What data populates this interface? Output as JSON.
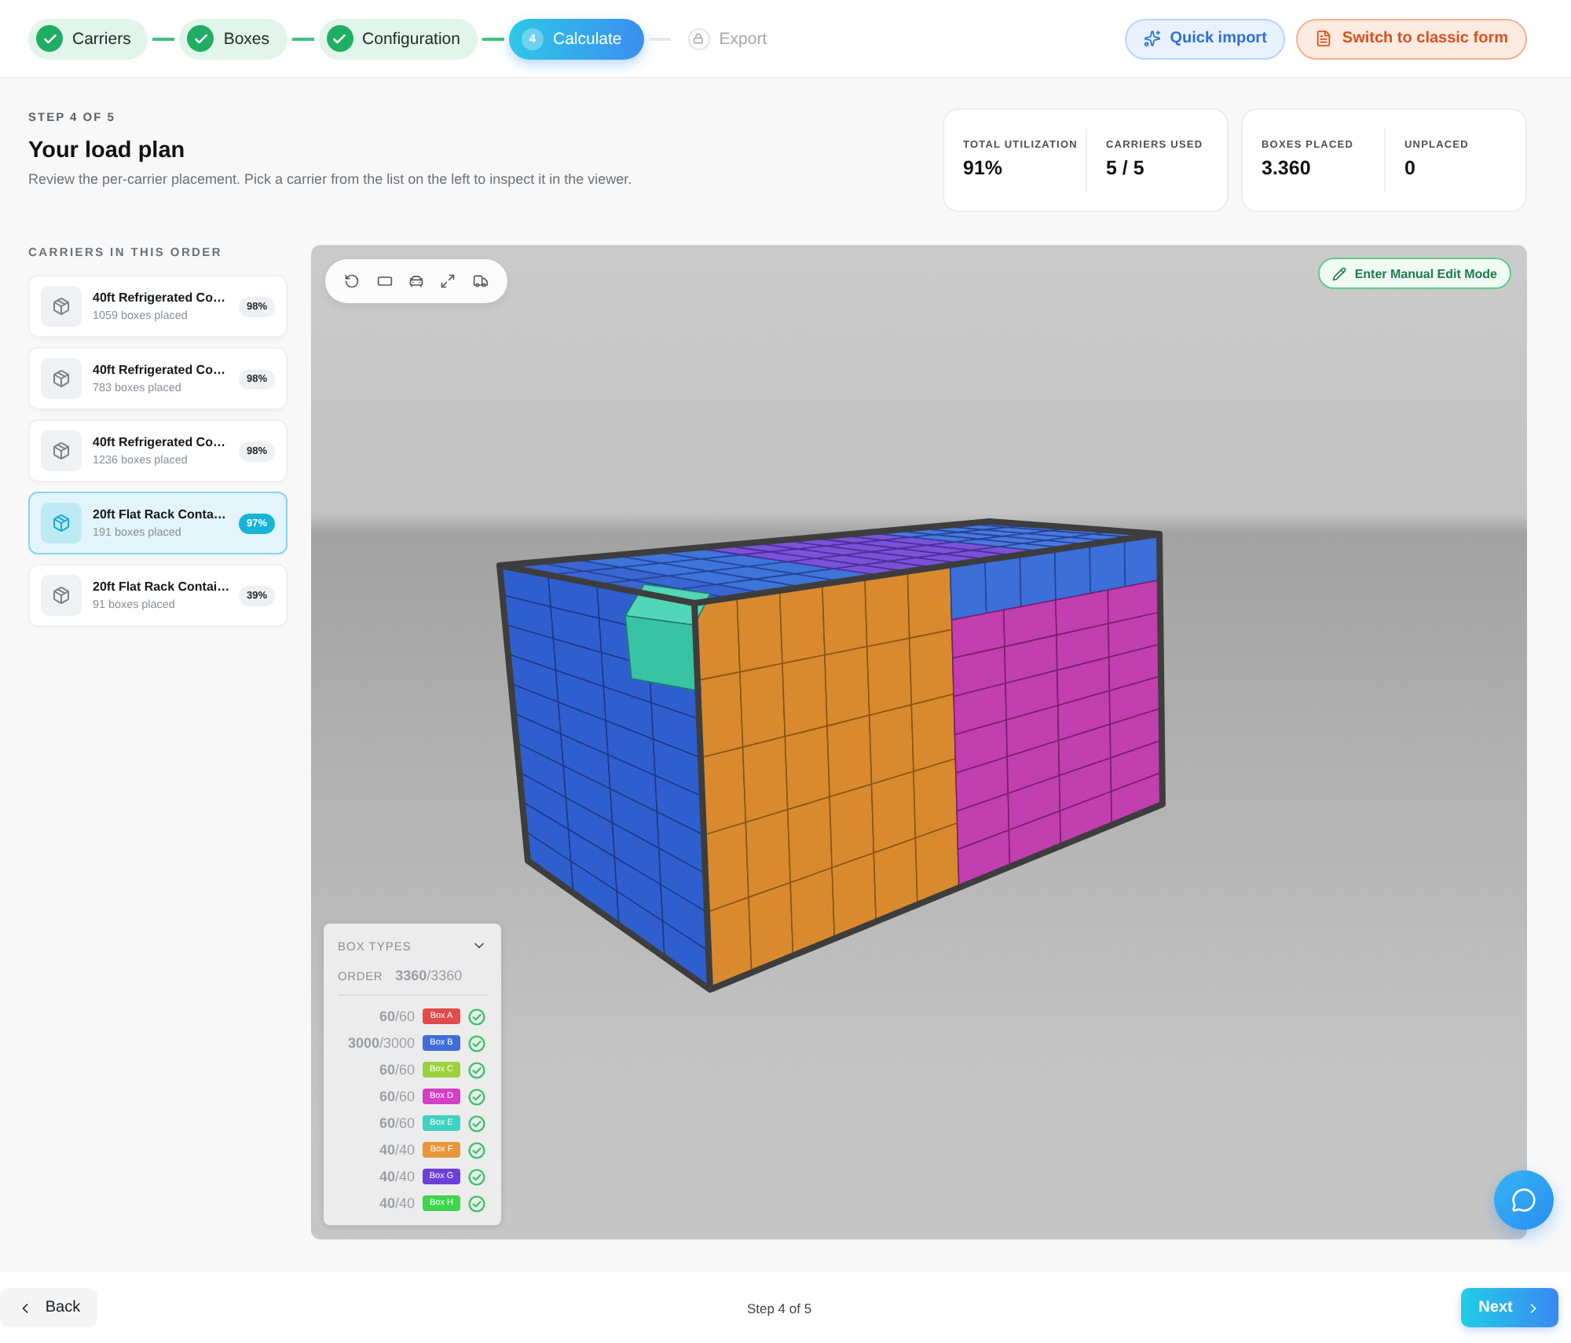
{
  "stepper": [
    {
      "label": "Carriers",
      "kind": "done"
    },
    {
      "label": "Boxes",
      "kind": "done"
    },
    {
      "label": "Configuration",
      "kind": "done"
    },
    {
      "label": "Calculate",
      "kind": "current",
      "number": "4"
    },
    {
      "label": "Export",
      "kind": "locked"
    }
  ],
  "header_actions": [
    {
      "kind": "import",
      "label": "Quick import"
    },
    {
      "kind": "classic",
      "label": "Switch to classic form"
    }
  ],
  "intro": {
    "eyebrow": "STEP 4 OF 5",
    "title": "Your load plan",
    "description": "Review the per-carrier placement. Pick a carrier from the list on the left to inspect it in the viewer."
  },
  "stat_cards": [
    {
      "stats": [
        {
          "label": "TOTAL UTILIZATION",
          "value": "91%"
        },
        {
          "label": "CARRIERS USED",
          "value": "5 / 5"
        }
      ]
    },
    {
      "stats": [
        {
          "label": "BOXES PLACED",
          "value": "3.360"
        },
        {
          "label": "UNPLACED",
          "value": "0"
        }
      ]
    }
  ],
  "carriers": {
    "heading": "CARRIERS IN THIS ORDER",
    "items": [
      {
        "name": "40ft Refrigerated Co…",
        "detail": "1059 boxes placed",
        "utilization": "98%",
        "selected": false
      },
      {
        "name": "40ft Refrigerated Co…",
        "detail": "783 boxes placed",
        "utilization": "98%",
        "selected": false
      },
      {
        "name": "40ft Refrigerated Co…",
        "detail": "1236 boxes placed",
        "utilization": "98%",
        "selected": false
      },
      {
        "name": "20ft Flat Rack Conta…",
        "detail": "191 boxes placed",
        "utilization": "97%",
        "selected": true
      },
      {
        "name": "20ft Flat Rack Contai…",
        "detail": "91 boxes placed",
        "utilization": "39%",
        "selected": false
      }
    ]
  },
  "viewer": {
    "edit_button": "Enter Manual Edit Mode",
    "box_types": {
      "title": "BOX TYPES",
      "order_label": "ORDER",
      "order_count": "**3360**/3360",
      "rows": [
        {
          "count": "**60**/60",
          "label": "Box A",
          "color": "#e04b4b",
          "complete": true
        },
        {
          "count": "**3000**/3000",
          "label": "Box B",
          "color": "#3e6fd9",
          "complete": true
        },
        {
          "count": "**60**/60",
          "label": "Box C",
          "color": "#9bd23c",
          "complete": true
        },
        {
          "count": "**60**/60",
          "label": "Box D",
          "color": "#d33fc6",
          "complete": true
        },
        {
          "count": "**60**/60",
          "label": "Box E",
          "color": "#3fd1c1",
          "complete": true
        },
        {
          "count": "**40**/40",
          "label": "Box F",
          "color": "#e8963c",
          "complete": true
        },
        {
          "count": "**40**/40",
          "label": "Box G",
          "color": "#6b3fd8",
          "complete": true
        },
        {
          "count": "**40**/40",
          "label": "Box H",
          "color": "#3fd44b",
          "complete": true
        }
      ]
    }
  },
  "footer": {
    "back": "Back",
    "step": "Step 4 of 5",
    "next": "Next"
  }
}
